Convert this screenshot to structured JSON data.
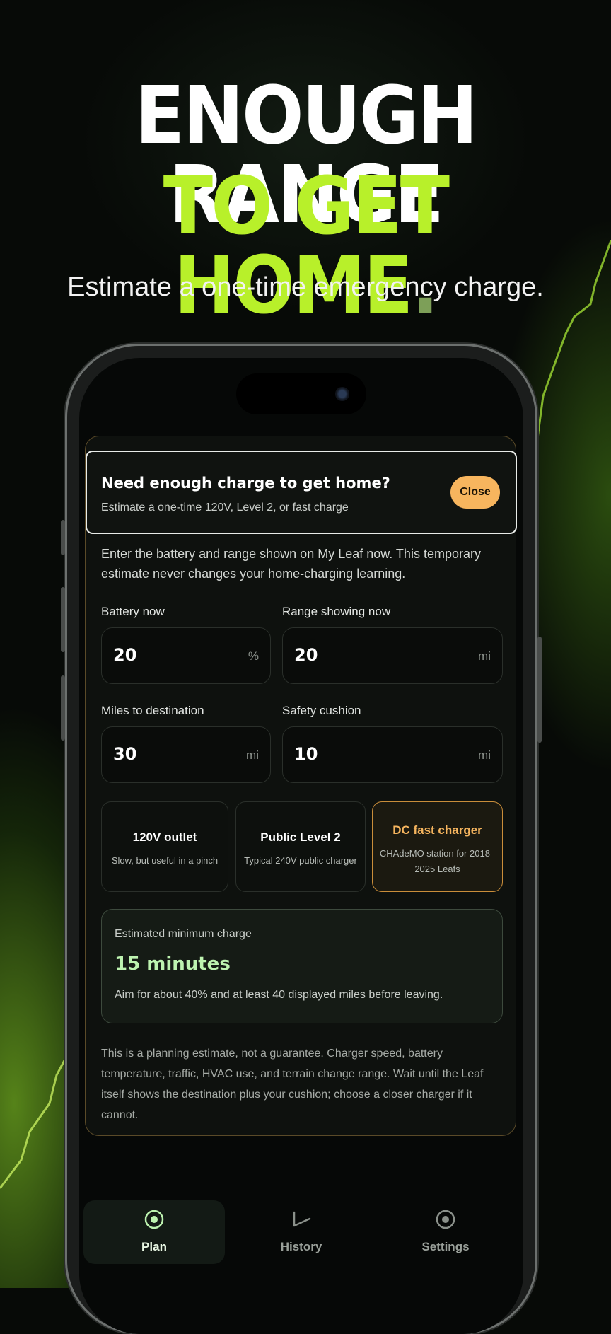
{
  "hero": {
    "line1": "ENOUGH RANGE",
    "line2": "TO GET HOME",
    "line2_dot": ".",
    "subtitle": "Estimate a one-time emergency charge."
  },
  "sheet": {
    "title": "Need enough charge to get home?",
    "subtitle": "Estimate a one-time 120V, Level 2, or fast charge",
    "close_label": "Close",
    "intro": "Enter the battery and range shown on My Leaf now. This temporary estimate never changes your home-charging learning."
  },
  "fields": {
    "battery": {
      "label": "Battery now",
      "value": "20",
      "unit": "%"
    },
    "range": {
      "label": "Range showing now",
      "value": "20",
      "unit": "mi"
    },
    "miles": {
      "label": "Miles to destination",
      "value": "30",
      "unit": "mi"
    },
    "cushion": {
      "label": "Safety cushion",
      "value": "10",
      "unit": "mi"
    }
  },
  "charger_options": [
    {
      "title": "120V outlet",
      "desc": "Slow, but useful in a pinch",
      "selected": false
    },
    {
      "title": "Public Level 2",
      "desc": "Typical 240V public charger",
      "selected": false
    },
    {
      "title": "DC fast charger",
      "desc": "CHAdeMO station for 2018–2025 Leafs",
      "selected": true
    }
  ],
  "estimate": {
    "label": "Estimated minimum charge",
    "value": "15 minutes",
    "note": "Aim for about 40% and at least 40 displayed miles before leaving."
  },
  "disclaimer": "This is a planning estimate, not a guarantee. Charger speed, battery temperature, traffic, HVAC use, and terrain change range. Wait until the Leaf itself shows the destination plus your cushion; choose a closer charger if it cannot.",
  "tabs": [
    {
      "label": "Plan",
      "icon": "target-icon",
      "active": true
    },
    {
      "label": "History",
      "icon": "chart-line-icon",
      "active": false
    },
    {
      "label": "Settings",
      "icon": "settings-icon",
      "active": false
    }
  ],
  "colors": {
    "accent_green": "#b8f02a",
    "accent_orange": "#f7b55e",
    "estimate_value": "#bdf3b0"
  }
}
